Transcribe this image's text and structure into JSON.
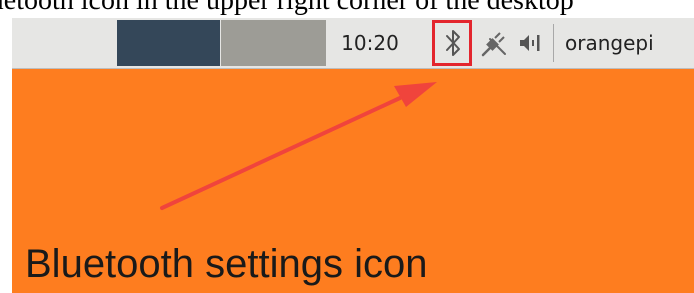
{
  "caption_top": "luetooth icon in the upper right corner of the desktop",
  "panel": {
    "clock": "10:20",
    "username": "orangepi",
    "icons": {
      "bluetooth": "bluetooth-icon",
      "network": "network-disconnected-icon",
      "volume": "volume-icon"
    }
  },
  "colors": {
    "desktop": "#fe7d1f",
    "highlight": "#e3252d",
    "arrow": "#f0443c"
  },
  "annotation": {
    "label": "Bluetooth settings icon"
  }
}
